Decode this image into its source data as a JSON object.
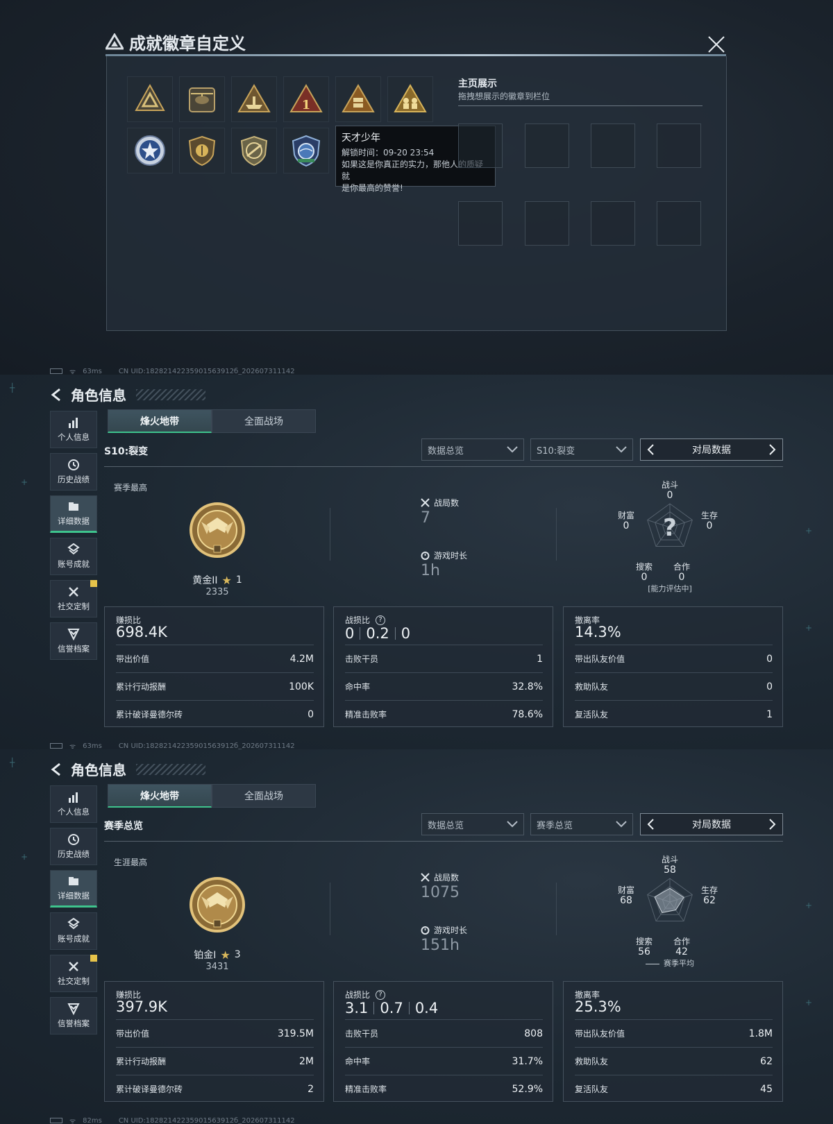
{
  "badge_dialog": {
    "title": "成就徽章自定义",
    "badges_row1": [
      "pyramid-badge",
      "helicopter-badge",
      "boat-badge",
      "rank-one-badge",
      "crate-badge",
      "soldiers-badge"
    ],
    "badges_row2": [
      "star-seal-badge",
      "shield-coin-badge",
      "rifle-shield-badge",
      "globe-badge"
    ],
    "showcase": {
      "title": "主页展示",
      "subtitle": "拖拽想展示的徽章到栏位"
    },
    "tooltip": {
      "name": "天才少年",
      "unlock_time": "解锁时间：09-20 23:54",
      "desc_line1": "如果这是你真正的实力，那他人的质疑就",
      "desc_line2": "是你最高的赞誉!"
    }
  },
  "status_bars": [
    {
      "ping": "63ms",
      "uid": "CN UID:18282142235901563912б_202607311142"
    },
    {
      "ping": "63ms",
      "uid": "CN UID:18282142235901563912б_202607311142"
    },
    {
      "ping": "82ms",
      "uid": "CN UID:18282142235901563912б_202607311142"
    }
  ],
  "role_common": {
    "title": "角色信息",
    "nav": [
      "个人信息",
      "历史战绩",
      "详细数据",
      "账号成就",
      "社交定制",
      "信誉档案"
    ],
    "tabs": [
      "烽火地带",
      "全面战场"
    ],
    "dropdown1": "数据总览",
    "pager_label": "对局数据",
    "label_games": "战局数",
    "label_time": "游戏时长",
    "radar_labels": {
      "combat": "战斗",
      "wealth": "财富",
      "survival": "生存",
      "search": "搜索",
      "coop": "合作"
    },
    "card1": {
      "title": "赚损比",
      "r1": "带出价值",
      "r2": "累计行动报酬",
      "r3": "累计破译曼德尔砖"
    },
    "card2": {
      "title": "战损比",
      "q": "?",
      "r1": "击败干员",
      "r2": "命中率",
      "r3": "精准击败率"
    },
    "card3": {
      "title": "撤离率",
      "r1": "带出队友价值",
      "r2": "救助队友",
      "r3": "复活队友"
    }
  },
  "panel_season": {
    "season_label": "S10:裂变",
    "dropdown2": "S10:裂变",
    "best_label": "赛季最高",
    "rank_name": "黄金II",
    "rank_stars": "1",
    "rank_score": "2335",
    "games": "7",
    "play_time": "1h",
    "radar": {
      "combat": "0",
      "wealth": "0",
      "survival": "0",
      "search": "0",
      "coop": "0",
      "note": "[能力评估中]",
      "center": "?"
    },
    "card1": {
      "value": "698.4K",
      "v1": "4.2M",
      "v2": "100K",
      "v3": "0"
    },
    "card2": {
      "k1": "0",
      "k2": "0.2",
      "k3": "0",
      "v1": "1",
      "v2": "32.8%",
      "v3": "78.6%"
    },
    "card3": {
      "value": "14.3%",
      "v1": "0",
      "v2": "0",
      "v3": "1"
    }
  },
  "panel_career": {
    "season_label": "赛季总览",
    "dropdown2": "赛季总览",
    "best_label": "生涯最高",
    "rank_name": "铂金I",
    "rank_stars": "3",
    "rank_score": "3431",
    "games": "1075",
    "play_time": "151h",
    "radar": {
      "combat": "58",
      "wealth": "68",
      "survival": "62",
      "search": "56",
      "coop": "42",
      "note": "赛季平均",
      "values": [
        0.58,
        0.62,
        0.42,
        0.56,
        0.68
      ]
    },
    "card1": {
      "value": "397.9K",
      "v1": "319.5M",
      "v2": "2M",
      "v3": "2"
    },
    "card2": {
      "k1": "3.1",
      "k2": "0.7",
      "k3": "0.4",
      "v1": "808",
      "v2": "31.7%",
      "v3": "52.9%"
    },
    "card3": {
      "value": "25.3%",
      "v1": "1.8M",
      "v2": "62",
      "v3": "45"
    }
  },
  "colors": {
    "accent_green": "#3ec48d",
    "gold": "#d9b85c",
    "background": "#1a232d"
  }
}
